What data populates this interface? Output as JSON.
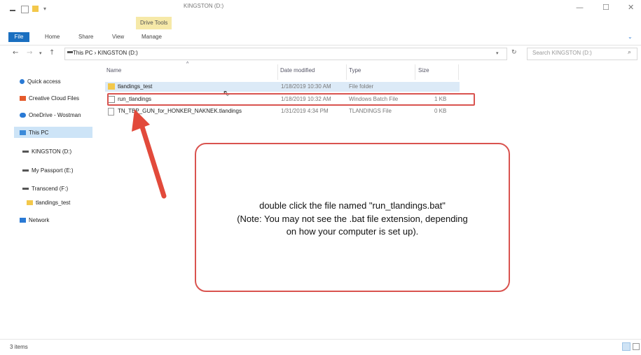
{
  "window": {
    "title": "KINGSTON (D:)",
    "contextual_tab": "Drive Tools",
    "controls": {
      "minimize": "—",
      "maximize": "☐",
      "close": "✕"
    }
  },
  "ribbon": {
    "tabs": [
      "File",
      "Home",
      "Share",
      "View",
      "Manage"
    ],
    "expand_icon": "⌄"
  },
  "address": {
    "path": "This PC  ›  KINGSTON (D:)",
    "search_placeholder": "Search KINGSTON (D:)"
  },
  "sidebar": {
    "items": [
      {
        "label": "Quick access",
        "icon": "star-icon",
        "color": "#2a7ad5"
      },
      {
        "label": "Creative Cloud Files",
        "icon": "creative-cloud-icon",
        "color": "#e55a2b"
      },
      {
        "label": "OneDrive - Wostman",
        "icon": "cloud-icon",
        "color": "#2a7ad5"
      },
      {
        "label": "This PC",
        "icon": "pc-icon",
        "color": "#3b8ad9"
      },
      {
        "label": "KINGSTON (D:)",
        "icon": "drive-icon",
        "color": "#555555"
      },
      {
        "label": "My Passport (E:)",
        "icon": "drive-icon",
        "color": "#555555"
      },
      {
        "label": "Transcend (F:)",
        "icon": "drive-icon",
        "color": "#555555"
      },
      {
        "label": "tlandings_test",
        "icon": "folder-icon",
        "color": "#f3c84b"
      },
      {
        "label": "Network",
        "icon": "network-icon",
        "color": "#2a7ad5"
      }
    ]
  },
  "files": {
    "columns": {
      "name": "Name",
      "date": "Date modified",
      "type": "Type",
      "size": "Size"
    },
    "rows": [
      {
        "name": "tlandings_test",
        "date": "1/18/2019 10:30 AM",
        "type": "File folder",
        "size": "",
        "icon": "folder-icon"
      },
      {
        "name": "run_tlandings",
        "date": "1/18/2019 10:32 AM",
        "type": "Windows Batch File",
        "size": "1 KB",
        "icon": "batch-file-icon"
      },
      {
        "name": "TN_TBP_GUN_for_HONKER_NAKNEK.tlandings",
        "date": "1/31/2019 4:34 PM",
        "type": "TLANDINGS File",
        "size": "0 KB",
        "icon": "file-icon"
      }
    ]
  },
  "callout": {
    "line1": "double click the file named \"run_tlandings.bat\"",
    "line2": "(Note:  You may not see the .bat file extension, depending",
    "line3": "on how your computer is set up)."
  },
  "status": {
    "item_count": "3 items"
  },
  "colors": {
    "annotation_red": "#d9534f",
    "accent_blue": "#1a6fc0"
  }
}
